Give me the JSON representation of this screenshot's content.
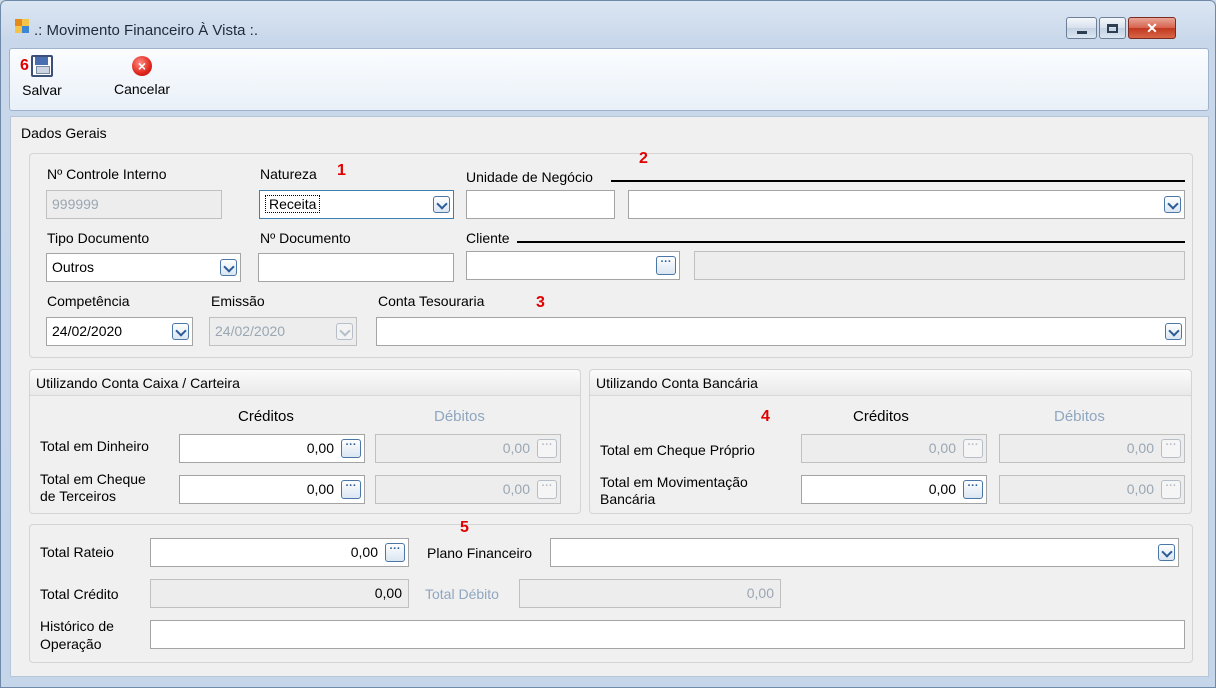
{
  "window": {
    "title": ".: Movimento Financeiro À Vista :.",
    "close_glyph": "✕"
  },
  "toolbar": {
    "marker": "6",
    "save_label": "Salvar",
    "cancel_label": "Cancelar"
  },
  "markers": [
    "1",
    "2",
    "3",
    "4",
    "5"
  ],
  "dados_gerais": {
    "legend": "Dados Gerais",
    "controle_interno": {
      "label": "Nº Controle Interno",
      "value": "999999"
    },
    "natureza": {
      "label": "Natureza",
      "value": "Receita"
    },
    "unidade_negocio": {
      "label": "Unidade de Negócio",
      "code": "",
      "value": ""
    },
    "tipo_documento": {
      "label": "Tipo Documento",
      "value": "Outros"
    },
    "numero_documento": {
      "label": "Nº Documento",
      "value": ""
    },
    "cliente": {
      "label": "Cliente",
      "code": "",
      "name": ""
    },
    "competencia": {
      "label": "Competência",
      "value": "24/02/2020"
    },
    "emissao": {
      "label": "Emissão",
      "value": "24/02/2020"
    },
    "conta_tesouraria": {
      "label": "Conta Tesouraria",
      "value": ""
    }
  },
  "conta_caixa": {
    "title": "Utilizando Conta Caixa / Carteira",
    "creditos_header": "Créditos",
    "debitos_header": "Débitos",
    "rows": [
      {
        "label": "Total em Dinheiro",
        "credito": "0,00",
        "debito": "0,00"
      },
      {
        "label_line1": "Total em Cheque",
        "label_line2": "de Terceiros",
        "credito": "0,00",
        "debito": "0,00"
      }
    ]
  },
  "conta_bancaria": {
    "title": "Utilizando Conta Bancária",
    "creditos_header": "Créditos",
    "debitos_header": "Débitos",
    "rows": [
      {
        "label": "Total em Cheque Próprio",
        "credito": "0,00",
        "debito": "0,00"
      },
      {
        "label_line1": "Total em Movimentação",
        "label_line2": "Bancária",
        "credito": "0,00",
        "debito": "0,00"
      }
    ]
  },
  "totais": {
    "total_rateio": {
      "label": "Total Rateio",
      "value": "0,00"
    },
    "plano_financeiro": {
      "label": "Plano Financeiro",
      "value": ""
    },
    "total_credito": {
      "label": "Total Crédito",
      "value": "0,00"
    },
    "total_debito": {
      "label": "Total Débito",
      "value": "0,00"
    },
    "historico": {
      "label_line1": "Histórico de",
      "label_line2": "Operação",
      "value": ""
    }
  },
  "icons": {
    "ellipsis": "···",
    "cancel": "×"
  },
  "colors": {
    "marker_red": "#e00000",
    "disabled_label": "#8fa6c0",
    "window_frame": "#c8d7ea"
  }
}
